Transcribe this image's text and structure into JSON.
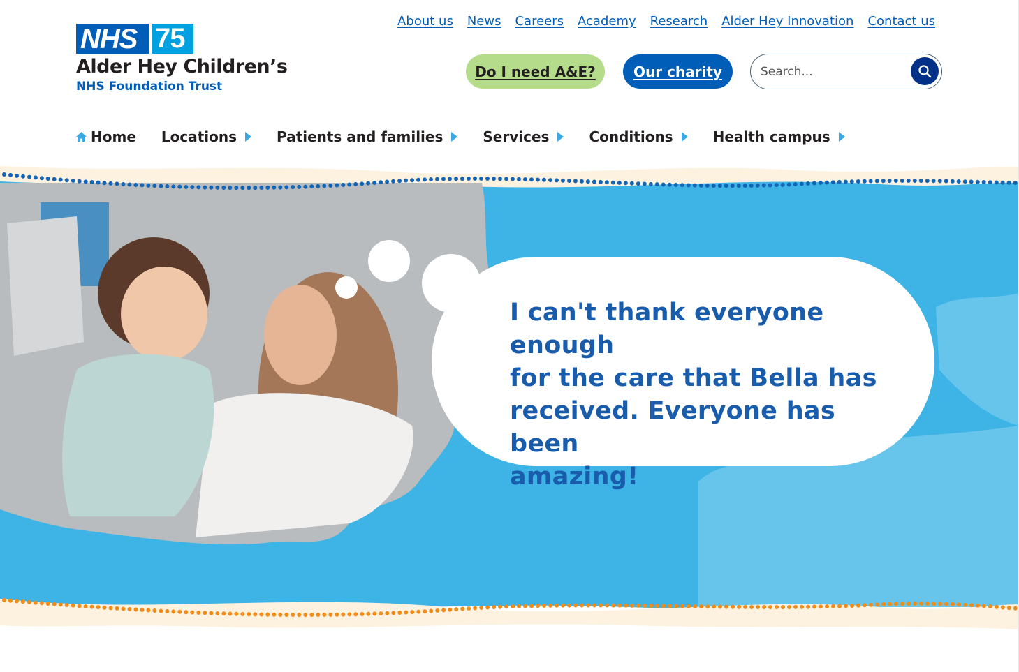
{
  "logo": {
    "nhs": "NHS",
    "anniversary": "75",
    "trust_name": "Alder Hey Children’s",
    "trust_sub": "NHS Foundation Trust"
  },
  "top_links": [
    "About us",
    "News",
    "Careers",
    "Academy",
    "Research",
    "Alder Hey Innovation",
    "Contact us"
  ],
  "actions": {
    "ae_label": "Do I need A&E?",
    "charity_label": "Our charity"
  },
  "search": {
    "placeholder": "Search...",
    "icon": "search-icon"
  },
  "main_nav": [
    {
      "label": "Home",
      "icon": "home-icon",
      "has_arrow": false
    },
    {
      "label": "Locations",
      "has_arrow": true
    },
    {
      "label": "Patients and families",
      "has_arrow": true
    },
    {
      "label": "Services",
      "has_arrow": true
    },
    {
      "label": "Conditions",
      "has_arrow": true
    },
    {
      "label": "Health campus",
      "has_arrow": true
    }
  ],
  "hero": {
    "quote_lines": [
      "I can't thank everyone enough",
      "for the care that Bella has",
      "received. Everyone has been",
      "amazing!"
    ]
  },
  "colors": {
    "nhs_blue": "#005eb8",
    "nhs_dark_blue": "#003087",
    "sky_blue": "#3db3e6",
    "ae_green": "#b5dc8a",
    "sand": "#fdf1df",
    "dot_orange": "#f08c1a"
  }
}
